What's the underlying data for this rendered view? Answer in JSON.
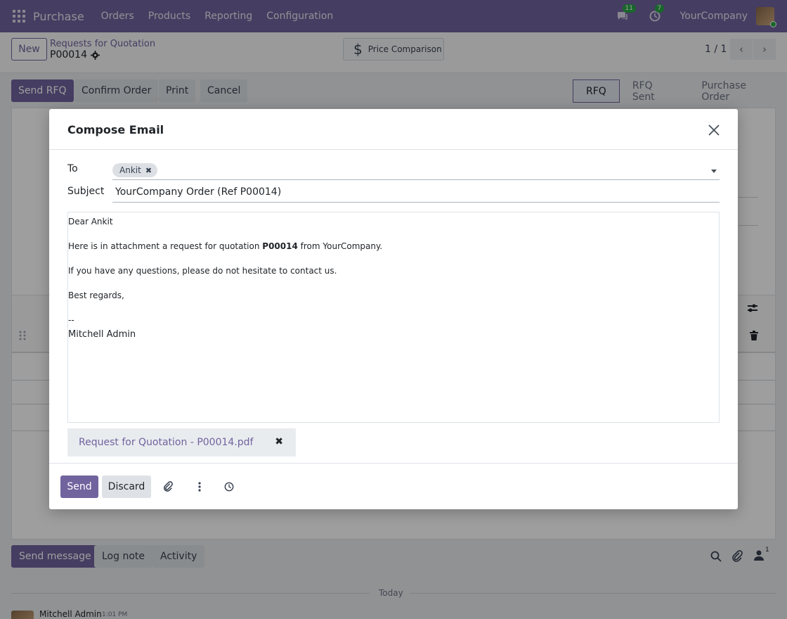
{
  "navbar": {
    "app_name": "Purchase",
    "menu": [
      "Orders",
      "Products",
      "Reporting",
      "Configuration"
    ],
    "messages_count": "11",
    "activities_count": "7",
    "company": "YourCompany"
  },
  "control_panel": {
    "new_label": "New",
    "breadcrumb_parent": "Requests for Quotation",
    "record_name": "P00014",
    "price_comparison_label": "Price Comparison",
    "pager": "1 / 1"
  },
  "form": {
    "actions": [
      "Send RFQ",
      "Confirm Order",
      "Print",
      "Cancel"
    ],
    "statuses": [
      "RFQ",
      "RFQ Sent",
      "Purchase Order"
    ],
    "active_status": "RFQ"
  },
  "chatter": {
    "buttons": [
      "Send message",
      "Log note",
      "Activity"
    ],
    "followers_count": "1",
    "date_separator": "Today",
    "message_author": "Mitchell Admin",
    "message_time": "1:01 PM"
  },
  "dialog": {
    "title": "Compose Email",
    "to_label": "To",
    "recipient": "Ankit",
    "subject_label": "Subject",
    "subject_value": "YourCompany Order (Ref P00014)",
    "body": {
      "greeting": "Dear Ankit",
      "line1_prefix": "Here is in attachment a request for quotation ",
      "line1_bold": "P00014",
      "line1_suffix": " from YourCompany.",
      "line2": "If you have any questions, please do not hesitate to contact us.",
      "closing": "Best regards,",
      "sig_dash": "--",
      "sig_name": "Mitchell Admin"
    },
    "attachment_name": "Request for Quotation - P00014.pdf",
    "send_label": "Send",
    "discard_label": "Discard"
  },
  "colors": {
    "brand": "#71639e",
    "badge": "#28a745"
  }
}
